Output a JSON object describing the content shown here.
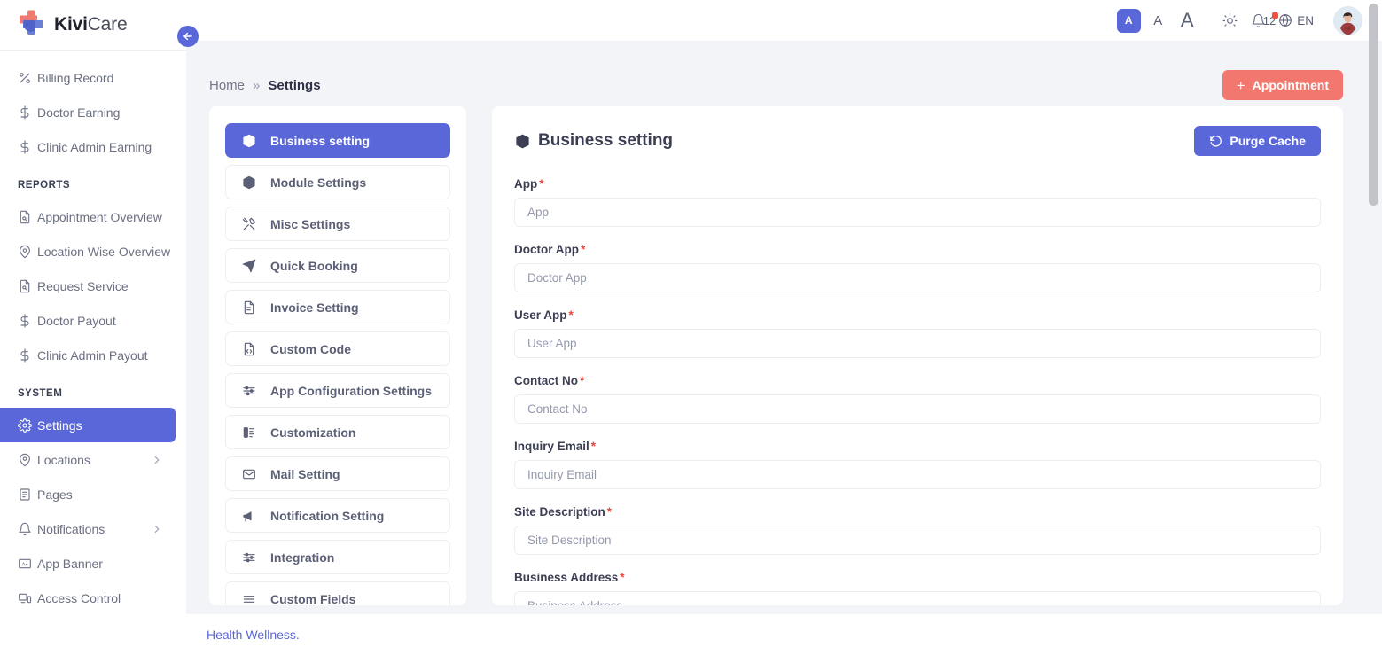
{
  "brand": {
    "name_bold": "Kivi",
    "name_light": "Care"
  },
  "sidebar": {
    "groups": [
      {
        "title": "",
        "items": [
          {
            "label": "Billing Record",
            "icon": "percent-icon",
            "caret": false,
            "active": false
          },
          {
            "label": "Doctor Earning",
            "icon": "dollar-icon",
            "caret": false,
            "active": false
          },
          {
            "label": "Clinic Admin Earning",
            "icon": "dollar-icon",
            "caret": false,
            "active": false
          }
        ]
      },
      {
        "title": "REPORTS",
        "items": [
          {
            "label": "Appointment Overview",
            "icon": "document-search-icon",
            "caret": false,
            "active": false
          },
          {
            "label": "Location Wise Overview",
            "icon": "map-pin-icon",
            "caret": false,
            "active": false
          },
          {
            "label": "Request Service",
            "icon": "document-search-icon",
            "caret": false,
            "active": false
          },
          {
            "label": "Doctor Payout",
            "icon": "dollar-icon",
            "caret": false,
            "active": false
          },
          {
            "label": "Clinic Admin Payout",
            "icon": "dollar-icon",
            "caret": false,
            "active": false
          }
        ]
      },
      {
        "title": "SYSTEM",
        "items": [
          {
            "label": "Settings",
            "icon": "gear-icon",
            "caret": false,
            "active": true
          },
          {
            "label": "Locations",
            "icon": "map-pin-icon",
            "caret": true,
            "active": false
          },
          {
            "label": "Pages",
            "icon": "page-icon",
            "caret": false,
            "active": false
          },
          {
            "label": "Notifications",
            "icon": "bell-icon",
            "caret": true,
            "active": false
          },
          {
            "label": "App Banner",
            "icon": "banner-icon",
            "caret": false,
            "active": false
          },
          {
            "label": "Access Control",
            "icon": "devices-icon",
            "caret": false,
            "active": false
          }
        ]
      }
    ]
  },
  "topbar": {
    "font_size_small": "A",
    "font_size_medium": "A",
    "font_size_large": "A",
    "notification_count": "12",
    "language": "EN",
    "theme_icon": "sun-icon",
    "globe_icon": "globe-icon",
    "avatar_alt": "user-avatar"
  },
  "back_button": {
    "icon": "arrow-left-icon"
  },
  "breadcrumb": {
    "home": "Home",
    "separator": "»",
    "current": "Settings"
  },
  "appointment_button": {
    "plus": "+",
    "label": "Appointment"
  },
  "settings_tabs": [
    {
      "label": "Business setting",
      "icon": "box-icon",
      "active": true
    },
    {
      "label": "Module Settings",
      "icon": "box-icon",
      "active": false
    },
    {
      "label": "Misc Settings",
      "icon": "tools-icon",
      "active": false
    },
    {
      "label": "Quick Booking",
      "icon": "send-icon",
      "active": false
    },
    {
      "label": "Invoice Setting",
      "icon": "invoice-icon",
      "active": false
    },
    {
      "label": "Custom Code",
      "icon": "code-file-icon",
      "active": false
    },
    {
      "label": "App Configuration Settings",
      "icon": "sliders-icon",
      "active": false
    },
    {
      "label": "Customization",
      "icon": "customize-icon",
      "active": false
    },
    {
      "label": "Mail Setting",
      "icon": "mail-icon",
      "active": false
    },
    {
      "label": "Notification Setting",
      "icon": "megaphone-icon",
      "active": false
    },
    {
      "label": "Integration",
      "icon": "sliders-icon",
      "active": false
    },
    {
      "label": "Custom Fields",
      "icon": "list-icon",
      "active": false
    }
  ],
  "business_setting": {
    "title": "Business setting",
    "title_icon": "box-icon",
    "purge_button": {
      "label": "Purge Cache",
      "icon": "refresh-icon"
    },
    "fields": [
      {
        "label": "App",
        "required": true,
        "placeholder": "App",
        "value": ""
      },
      {
        "label": "Doctor App",
        "required": true,
        "placeholder": "Doctor App",
        "value": ""
      },
      {
        "label": "User App",
        "required": true,
        "placeholder": "User App",
        "value": ""
      },
      {
        "label": "Contact No",
        "required": true,
        "placeholder": "Contact No",
        "value": ""
      },
      {
        "label": "Inquiry Email",
        "required": true,
        "placeholder": "Inquiry Email",
        "value": ""
      },
      {
        "label": "Site Description",
        "required": true,
        "placeholder": "Site Description",
        "value": ""
      },
      {
        "label": "Business Address",
        "required": true,
        "placeholder": "Business Address",
        "value": ""
      }
    ]
  },
  "footer": {
    "link": "Health Wellness."
  },
  "colors": {
    "accent": "#5a67d8",
    "danger": "#f2776f",
    "required": "#e8453c",
    "page_bg": "#f3f4f8",
    "text": "#3c3f53",
    "muted": "#6b6f82"
  }
}
